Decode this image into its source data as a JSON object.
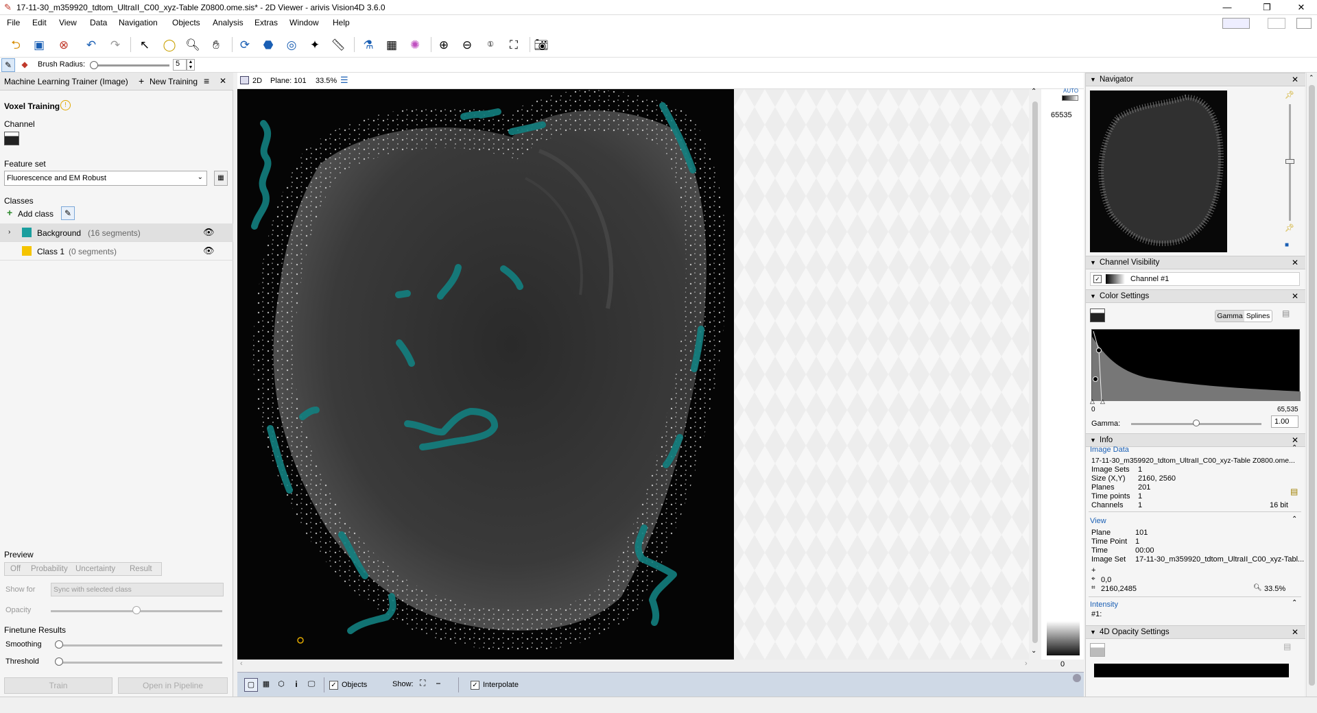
{
  "window": {
    "title": "17-11-30_m359920_tdtom_UltraII_C00_xyz-Table Z0800.ome.sis* - 2D Viewer - arivis Vision4D 3.6.0",
    "minimize": "—",
    "maximize": "❐",
    "close": "✕"
  },
  "menu": [
    "File",
    "Edit",
    "View",
    "Data",
    "Navigation",
    "Objects",
    "Analysis",
    "Extras",
    "Window",
    "Help"
  ],
  "brush": {
    "label": "Brush Radius:",
    "value": "5"
  },
  "left_panel": {
    "header": "Machine Learning Trainer (Image)",
    "new_training": "New Training",
    "section_title": "Voxel Training",
    "channel_label": "Channel",
    "feature_set_label": "Feature set",
    "feature_set_value": "Fluorescence and EM Robust",
    "classes_label": "Classes",
    "add_class": "Add class",
    "classes": [
      {
        "name": "Background",
        "count": "(16 segments)",
        "color": "#1a9e9e"
      },
      {
        "name": "Class 1",
        "count": "(0 segments)",
        "color": "#f5c400"
      }
    ],
    "preview_label": "Preview",
    "preview_tabs": [
      "Off",
      "Probability",
      "Uncertainty",
      "Result"
    ],
    "show_for_label": "Show for",
    "show_for_value": "Sync with selected class",
    "opacity_label": "Opacity",
    "finetune_label": "Finetune Results",
    "smoothing_label": "Smoothing",
    "threshold_label": "Threshold",
    "train_button": "Train",
    "open_pipeline_button": "Open in Pipeline"
  },
  "viewer": {
    "mode": "2D",
    "plane": "Plane: 101",
    "zoom": "33.5%",
    "intensity_max": "65535",
    "intensity_min": "0",
    "auto_label": "AUTO",
    "objects_label": "Objects",
    "show_label": "Show:",
    "interpolate_label": "Interpolate"
  },
  "right_panel": {
    "navigator": "Navigator",
    "channel_visibility": "Channel Visibility",
    "channel_name": "Channel #1",
    "color_settings": "Color Settings",
    "gamma_tab": "Gamma",
    "splines_tab": "Splines",
    "hist_min": "0",
    "hist_max": "65,535",
    "gamma_label": "Gamma:",
    "gamma_value": "1.00",
    "info": "Info",
    "image_data_label": "Image Data",
    "image_file": "17-11-30_m359920_tdtom_UltraII_C00_xyz-Table Z0800.ome...",
    "image_data": [
      {
        "k": "Image Sets",
        "v": "1"
      },
      {
        "k": "Size (X,Y)",
        "v": "2160, 2560"
      },
      {
        "k": "Planes",
        "v": "201"
      },
      {
        "k": "Time points",
        "v": "1"
      },
      {
        "k": "Channels",
        "v": "1"
      }
    ],
    "bit_depth": "16 bit",
    "view_label": "View",
    "view_data": [
      {
        "k": "Plane",
        "v": "101"
      },
      {
        "k": "Time Point",
        "v": "1"
      },
      {
        "k": "Time",
        "v": "00:00"
      },
      {
        "k": "Image Set",
        "v": "17-11-30_m359920_tdtom_UltraII_C00_xyz-Tabl..."
      }
    ],
    "cursor_pos": "0,0",
    "image_extent": "2160,2485",
    "view_zoom": "33.5%",
    "intensity_label": "Intensity",
    "intensity_channel": "#1:",
    "opacity_settings": "4D Opacity Settings"
  }
}
